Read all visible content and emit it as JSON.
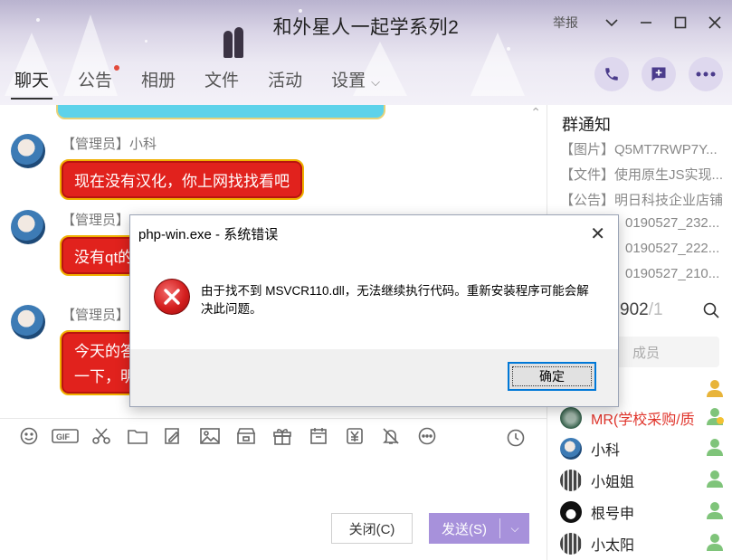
{
  "window": {
    "title": "和外星人一起学系列2",
    "report_label": "举报",
    "controls": [
      "dropdown",
      "minimize",
      "maximize",
      "close"
    ]
  },
  "tabs": [
    {
      "label": "聊天",
      "active": true
    },
    {
      "label": "公告",
      "badge": true
    },
    {
      "label": "相册"
    },
    {
      "label": "文件"
    },
    {
      "label": "活动"
    },
    {
      "label": "设置"
    }
  ],
  "header_actions": [
    "phone-icon",
    "add-message-icon",
    "more-icon"
  ],
  "chat": {
    "messages": [
      {
        "sender": "【管理员】小科",
        "text": "现在没有汉化，你上网找找看吧"
      },
      {
        "sender": "【管理员】",
        "text": "没有qt的"
      },
      {
        "sender": "【管理员】",
        "text": "今天的答",
        "text2": "一下，明"
      }
    ]
  },
  "toolbar": {
    "icons": [
      "emoji-icon",
      "gif-icon",
      "scissors-icon",
      "folder-icon",
      "doodle-icon",
      "image-icon",
      "shop-icon",
      "gift-icon",
      "calendar-icon",
      "yuan-icon",
      "bell-icon",
      "more-dots-icon"
    ],
    "history_icon": "clock-icon"
  },
  "actions": {
    "close_label": "关闭(C)",
    "send_label": "发送(S)"
  },
  "notice": {
    "title": "群通知",
    "items": [
      "【图片】Q5MT7RWP7Y...",
      "【文件】使用原生JS实现...",
      "【公告】明日科技企业店铺",
      "0190527_232...",
      "0190527_222...",
      "0190527_210..."
    ]
  },
  "members": {
    "online": "902",
    "total": "/1",
    "search_placeholder": "成员",
    "list": [
      {
        "name": "MR(学校采购/质",
        "admin": true
      },
      {
        "name": "小科"
      },
      {
        "name": "小姐姐"
      },
      {
        "name": "根号申"
      },
      {
        "name": "小太阳"
      }
    ]
  },
  "dialog": {
    "title": "php-win.exe - 系统错误",
    "message": "由于找不到 MSVCR110.dll，无法继续执行代码。重新安装程序可能会解决此问题。",
    "ok_label": "确定"
  },
  "colors": {
    "accent": "#a791db",
    "bubble_red": "#e1221d",
    "error_red": "#d41f1f",
    "dialog_focus": "#0078d7"
  }
}
